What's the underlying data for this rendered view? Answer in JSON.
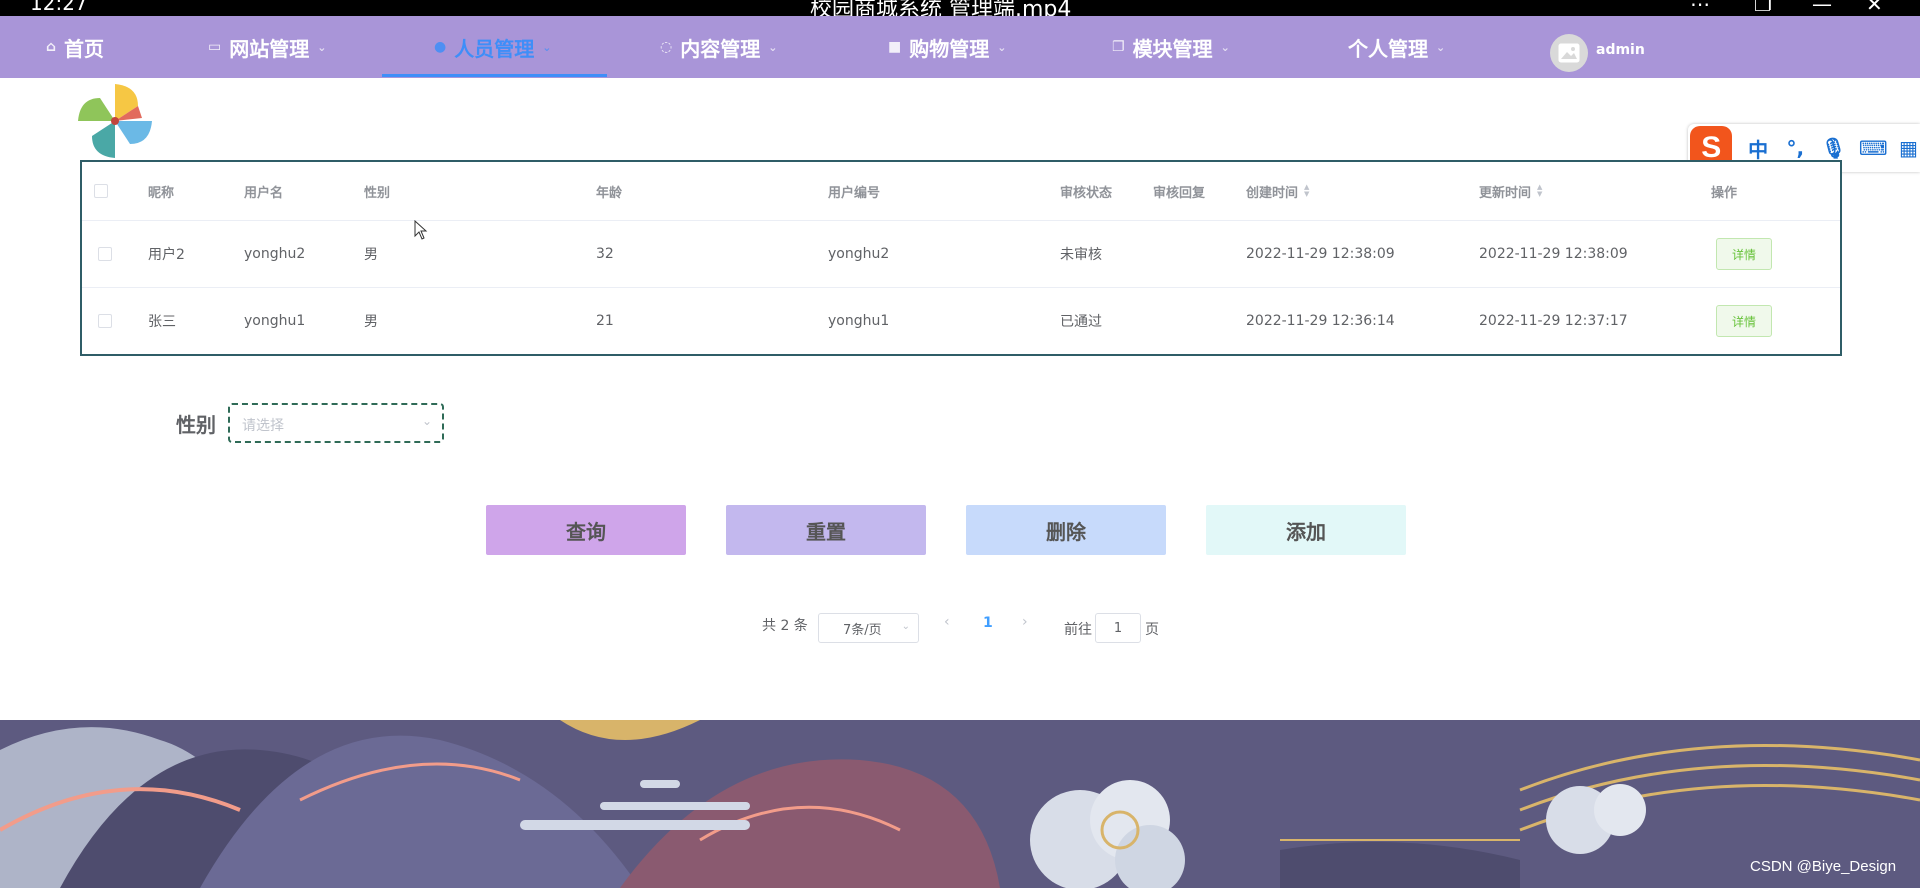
{
  "window": {
    "clock": "12:27",
    "title": "校园商城系统 管理端.mp4"
  },
  "nav": {
    "items": [
      {
        "label": "首页",
        "icon": "home-icon"
      },
      {
        "label": "网站管理",
        "icon": "monitor-icon"
      },
      {
        "label": "人员管理",
        "icon": "user-icon",
        "active": true
      },
      {
        "label": "内容管理",
        "icon": "message-icon"
      },
      {
        "label": "购物管理",
        "icon": "lock-icon"
      },
      {
        "label": "模块管理",
        "icon": "copy-icon"
      },
      {
        "label": "个人管理",
        "icon": ""
      }
    ],
    "user": "admin",
    "colors": {
      "bar": "#a995d8",
      "active": "#3f8ef8"
    }
  },
  "ime": {
    "logo": "S",
    "lang": "中",
    "punct": "°,"
  },
  "table": {
    "headers": [
      "昵称",
      "用户名",
      "性别",
      "年龄",
      "用户编号",
      "审核状态",
      "审核回复",
      "创建时间",
      "更新时间",
      "操作"
    ],
    "rows": [
      [
        "用户2",
        "yonghu2",
        "男",
        "32",
        "yonghu2",
        "未审核",
        "",
        "2022-11-29 12:38:09",
        "2022-11-29 12:38:09",
        "详情"
      ],
      [
        "张三",
        "yonghu1",
        "男",
        "21",
        "yonghu1",
        "已通过",
        "",
        "2022-11-29 12:36:14",
        "2022-11-29 12:37:17",
        "详情"
      ]
    ]
  },
  "filter": {
    "label": "性别",
    "placeholder": "请选择"
  },
  "buttons": {
    "query": "查询",
    "reset": "重置",
    "delete": "删除",
    "add": "添加"
  },
  "pagination": {
    "total": "共 2 条",
    "page_size": "7条/页",
    "current": "1",
    "goto": "前往",
    "goto_value": "1",
    "page_unit": "页"
  },
  "watermark": "CSDN @Biye_Design"
}
